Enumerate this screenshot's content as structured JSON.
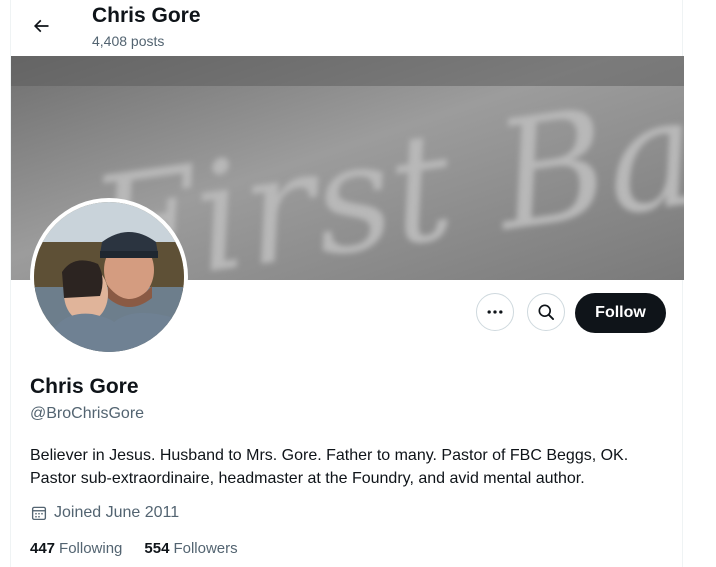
{
  "header": {
    "name": "Chris Gore",
    "post_count": "4,408 posts"
  },
  "banner": {
    "text": "First Bapti"
  },
  "actions": {
    "follow_label": "Follow"
  },
  "profile": {
    "name": "Chris Gore",
    "handle": "@BroChrisGore",
    "bio_line1": "Believer in Jesus. Husband to Mrs. Gore. Father to many. Pastor of FBC Beggs, OK.",
    "bio_line2": "Pastor sub-extraordinaire, headmaster at the Foundry, and avid mental author.",
    "joined": "Joined June 2011"
  },
  "stats": {
    "following_count": "447",
    "following_label": "Following",
    "followers_count": "554",
    "followers_label": "Followers"
  },
  "icons": {
    "back": "back-arrow-icon",
    "more": "more-dots-icon",
    "search": "search-icon",
    "calendar": "calendar-icon"
  },
  "colors": {
    "text_primary": "#0f1419",
    "text_secondary": "#536471",
    "follow_bg": "#0f1419",
    "border": "#cfd9de"
  }
}
